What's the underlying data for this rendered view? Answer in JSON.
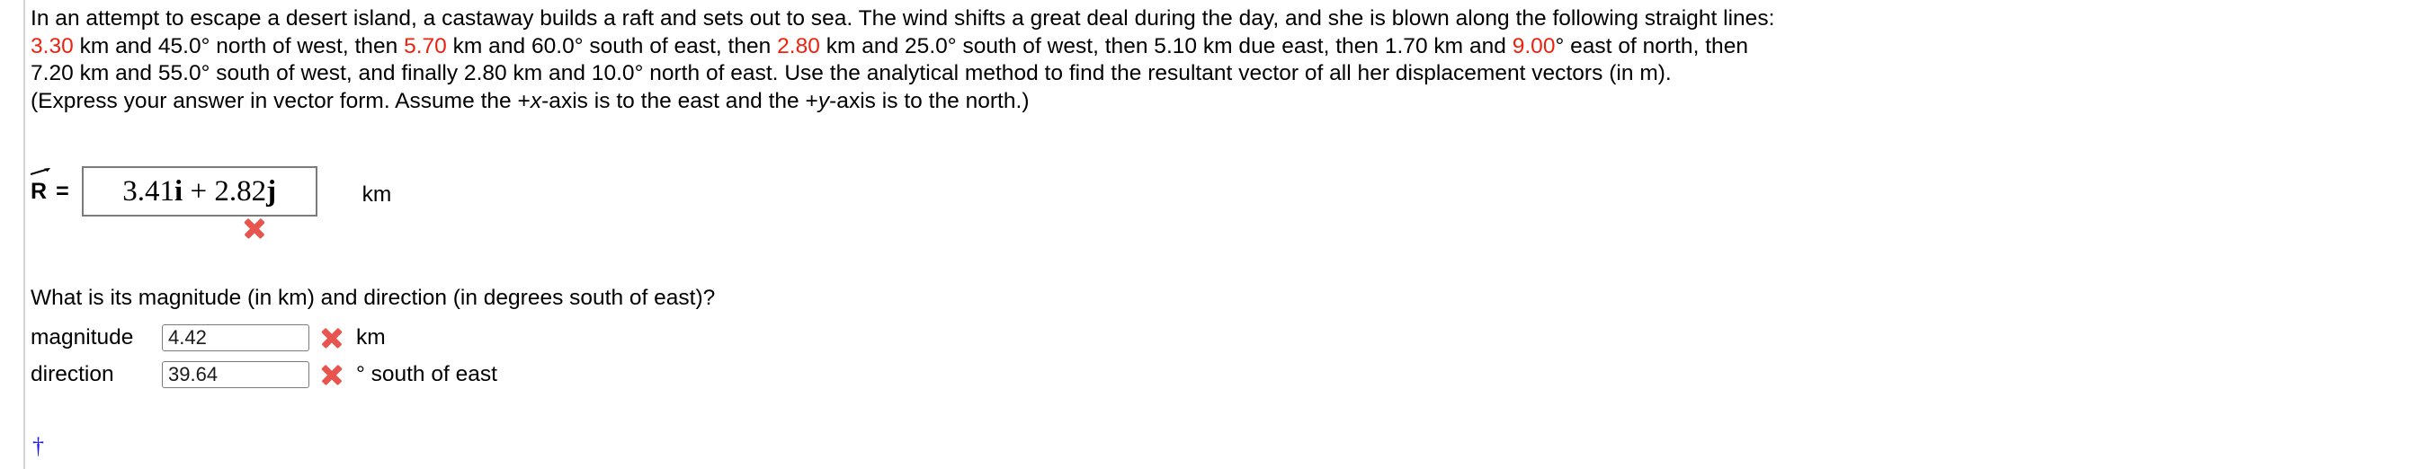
{
  "problem": {
    "lines": [
      [
        {
          "t": "In an attempt to escape a desert island, a castaway builds a raft and sets out to sea. The wind shifts a great deal during the day, and she is blown along the following straight lines:",
          "s": "plain"
        }
      ],
      [
        {
          "t": "3.30",
          "s": "hl"
        },
        {
          "t": " km and 45.0° north of west, then ",
          "s": "plain"
        },
        {
          "t": "5.70",
          "s": "hl"
        },
        {
          "t": " km and 60.0° south of east, then ",
          "s": "plain"
        },
        {
          "t": "2.80",
          "s": "hl"
        },
        {
          "t": " km and 25.0° south of west, then 5.10 km due east, then 1.70 km and ",
          "s": "plain"
        },
        {
          "t": "9.00",
          "s": "hl"
        },
        {
          "t": "° east of north, then",
          "s": "plain"
        }
      ],
      [
        {
          "t": "7.20 km and 55.0° south of west, and finally 2.80 km and 10.0° north of east. Use the analytical method to find the resultant vector of all her displacement vectors (in m).",
          "s": "plain"
        }
      ],
      [
        {
          "t": "(Express your answer in vector form. Assume the +",
          "s": "plain"
        },
        {
          "t": "x",
          "s": "ital"
        },
        {
          "t": "-axis is to the east and the +",
          "s": "plain"
        },
        {
          "t": "y",
          "s": "ital"
        },
        {
          "t": "-axis is to the north.)",
          "s": "plain"
        }
      ]
    ]
  },
  "vector_answer": {
    "label_symbol": "R",
    "equals": "=",
    "value": "3.41i + 2.82j",
    "value_parts": [
      {
        "t": "3.41",
        "s": "plain"
      },
      {
        "t": "i",
        "s": "bf"
      },
      {
        "t": " + ",
        "s": "plain"
      },
      {
        "t": "2.82",
        "s": "plain"
      },
      {
        "t": "j",
        "s": "bf"
      }
    ],
    "unit": "km",
    "status": "incorrect",
    "status_icon": "red-x-icon"
  },
  "question": {
    "text": "What is its magnitude (in km) and direction (in degrees south of east)?"
  },
  "fields": [
    {
      "label": "magnitude",
      "value": "4.42",
      "placeholder": "",
      "unit": "km",
      "status": "incorrect",
      "status_icon": "red-x-icon"
    },
    {
      "label": "direction",
      "value": "39.64",
      "placeholder": "",
      "unit": "° south of east",
      "status": "incorrect",
      "status_icon": "red-x-icon"
    }
  ],
  "footnote": {
    "marker": "†"
  },
  "colors": {
    "highlight": "#ee2211",
    "incorrect": "#e8554e",
    "footnote": "#1a13f0",
    "rule": "#d4d4d4",
    "box_border": "#7b7b7b"
  }
}
